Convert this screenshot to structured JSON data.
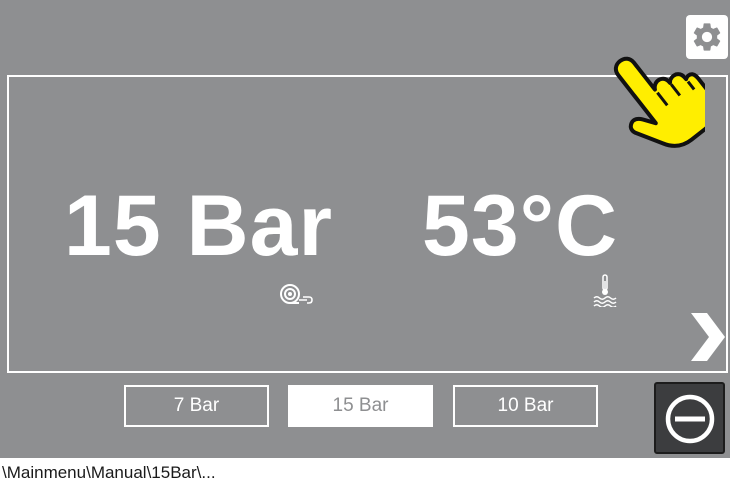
{
  "settings": {
    "icon": "gear-icon"
  },
  "display": {
    "pressure": "15 Bar",
    "temperature": "53°C",
    "pressure_icon": "pump-icon",
    "temperature_icon": "water-temperature-icon",
    "next_icon": "chevron-right-icon"
  },
  "presets": [
    {
      "label": "7 Bar",
      "active": false
    },
    {
      "label": "15 Bar",
      "active": true
    },
    {
      "label": "10 Bar",
      "active": false
    }
  ],
  "stop_button": {
    "icon": "stop-circle-icon"
  },
  "pointer": {
    "icon": "hand-pointer-icon"
  },
  "path": "\\Mainmenu\\Manual\\15Bar\\...",
  "colors": {
    "screen_bg": "#8e8f91",
    "foreground": "#ffffff",
    "stop_button_bg": "#3c3d3f",
    "pointer_fill": "#ffee00"
  }
}
